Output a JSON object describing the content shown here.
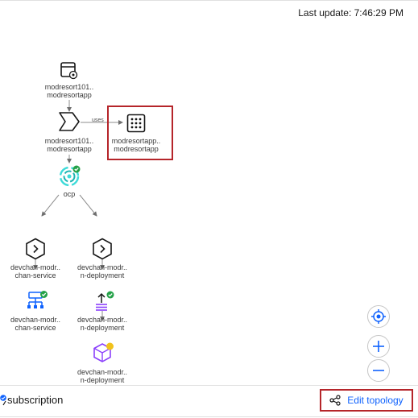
{
  "header": {
    "last_update": "Last update: 7:46:29 PM"
  },
  "topology": {
    "nodes": [
      {
        "id": "app-config",
        "line1": "modresort101..",
        "line2": "modresortapp",
        "icon": "application-config-icon"
      },
      {
        "id": "subscription",
        "line1": "modresort101..",
        "line2": "modresortapp",
        "icon": "subscription-chevron-icon"
      },
      {
        "id": "application",
        "line1": "modresortapp..",
        "line2": "modresortapp",
        "icon": "application-grid-icon"
      },
      {
        "id": "cluster",
        "line1": "ocp",
        "line2": "",
        "icon": "openshift-cluster-icon"
      },
      {
        "id": "service-chevron",
        "line1": "devchan-modr..",
        "line2": "chan-service",
        "icon": "service-chevron-icon"
      },
      {
        "id": "deploy-chevron",
        "line1": "devchan-modr..",
        "line2": "n-deployment",
        "icon": "deployment-chevron-icon"
      },
      {
        "id": "service",
        "line1": "devchan-modr..",
        "line2": "chan-service",
        "icon": "service-network-icon"
      },
      {
        "id": "deployment",
        "line1": "devchan-modr..",
        "line2": "n-deployment",
        "icon": "deployment-icon"
      },
      {
        "id": "pod",
        "line1": "devchan-modr..",
        "line2": "n-deployment",
        "icon": "pod-cube-icon"
      }
    ],
    "edge_label": "uses"
  },
  "footer": {
    "subscription_label": "subscription",
    "edit_topology": "Edit topology"
  },
  "colors": {
    "highlight": "#b5252a",
    "link": "#0f62fe",
    "success": "#24a148",
    "warning": "#f1c21b",
    "teal": "#3ddbd9",
    "purple": "#8a3ffc"
  }
}
